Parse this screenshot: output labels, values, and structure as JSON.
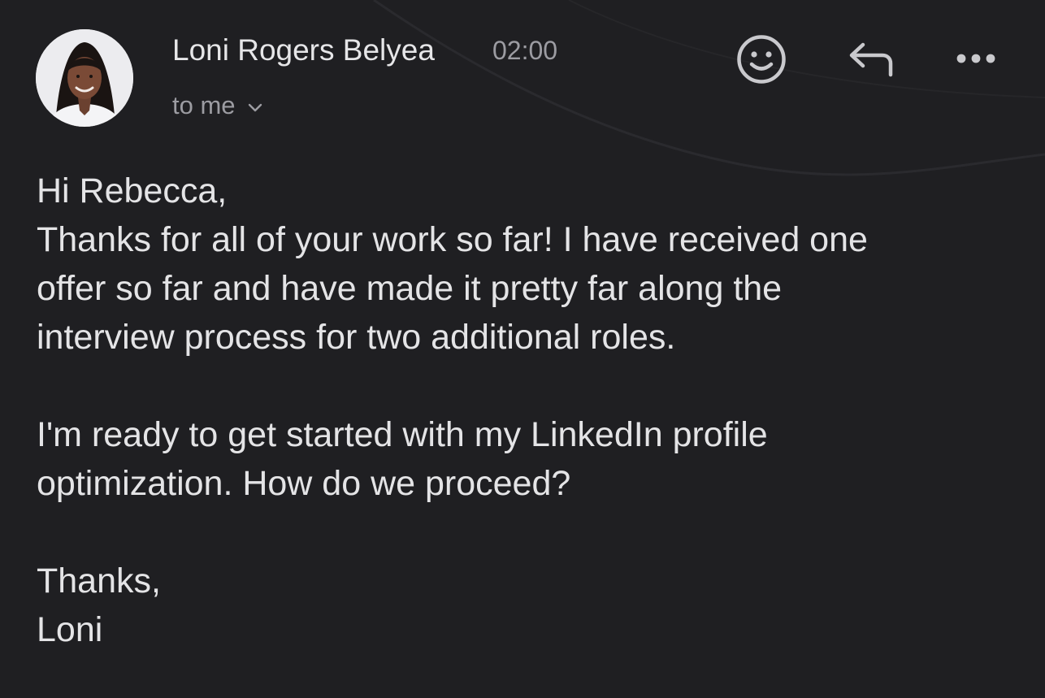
{
  "message": {
    "sender": "Loni Rogers Belyea",
    "time": "02:00",
    "recipient": "to me",
    "avatar_icon": "sender-photo"
  },
  "toolbar": {
    "react_icon": "smiley-icon",
    "reply_icon": "reply-icon",
    "more_icon": "more-icon"
  },
  "body": {
    "greeting": "Hi Rebecca,",
    "para1": [
      "Thanks for all of your work so far! I have received one",
      "offer so far and have made it pretty far along the",
      "interview process for two additional roles."
    ],
    "para2": [
      "I'm ready to get started with my LinkedIn profile",
      "optimization. How do we proceed?"
    ],
    "closing": "Thanks,",
    "signature": "Loni"
  },
  "colors": {
    "background": "#1f1f22",
    "primary_text": "#e4e4e6",
    "secondary_text": "#9c9ca2"
  }
}
